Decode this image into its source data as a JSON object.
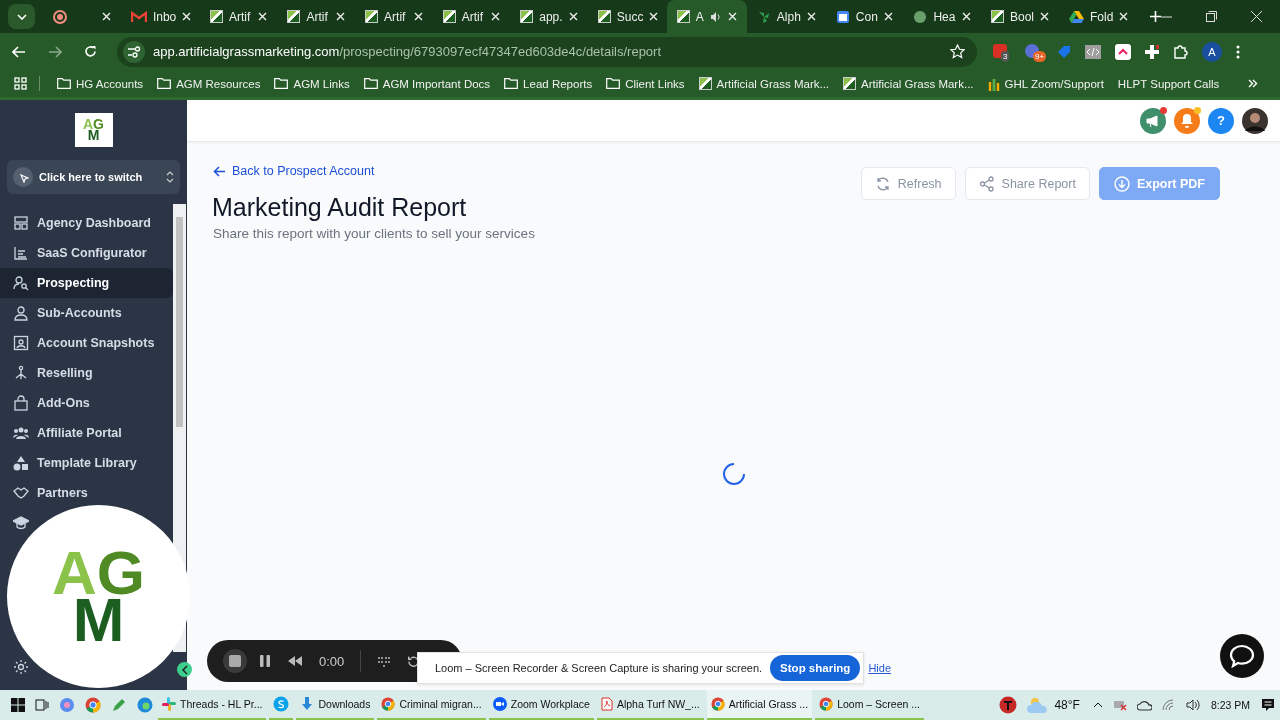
{
  "browser": {
    "tabs": [
      {
        "kind": "record",
        "selected": false
      },
      {
        "kind": "mail",
        "title": "Inbo",
        "selected": false
      },
      {
        "kind": "agm",
        "title": "Artif",
        "selected": false
      },
      {
        "kind": "agm",
        "title": "Artif",
        "selected": false
      },
      {
        "kind": "agm",
        "title": "Artif",
        "selected": false
      },
      {
        "kind": "agm",
        "title": "Artif",
        "selected": false
      },
      {
        "kind": "agm",
        "title": "app.",
        "selected": false
      },
      {
        "kind": "agm",
        "title": "Succ",
        "selected": false
      },
      {
        "kind": "agm",
        "title": "A",
        "selected": true,
        "audio": true
      },
      {
        "kind": "leaf",
        "title": "Alph",
        "selected": false
      },
      {
        "kind": "calendar",
        "title": "Con",
        "selected": false
      },
      {
        "kind": "globe",
        "title": "Hea",
        "selected": false
      },
      {
        "kind": "agm",
        "title": "Bool",
        "selected": false
      },
      {
        "kind": "drive",
        "title": "Fold",
        "selected": false
      }
    ],
    "url_host": "app.artificialgrassmarketing.com",
    "url_path": "/prospecting/6793097ecf47347ed603de4c/details/report",
    "extension_badges": [
      "3",
      "9+"
    ],
    "profile": "A",
    "bookmarks": [
      {
        "kind": "folder",
        "title": "HG Accounts"
      },
      {
        "kind": "folder",
        "title": "AGM Resources"
      },
      {
        "kind": "folder",
        "title": "AGM Links"
      },
      {
        "kind": "folder",
        "title": "AGM Important Docs"
      },
      {
        "kind": "folder",
        "title": "Lead Reports"
      },
      {
        "kind": "folder",
        "title": "Client Links"
      },
      {
        "kind": "agm",
        "title": "Artificial Grass Mark..."
      },
      {
        "kind": "agm",
        "title": "Artificial Grass Mark..."
      },
      {
        "kind": "bars",
        "title": "GHL Zoom/Support"
      },
      {
        "kind": "none",
        "title": "HLPT Support Calls"
      }
    ]
  },
  "sidebar_logo": [
    "A",
    "G",
    "M"
  ],
  "camera_logo": [
    "A",
    "G",
    "M"
  ],
  "switcher": "Click here to switch",
  "sidebar": {
    "items": [
      {
        "kind": "dashboard",
        "label": "Agency Dashboard",
        "selected": false
      },
      {
        "kind": "list",
        "label": "SaaS Configurator",
        "selected": false
      },
      {
        "kind": "search-person",
        "label": "Prospecting",
        "selected": true
      },
      {
        "kind": "person",
        "label": "Sub-Accounts",
        "selected": false
      },
      {
        "kind": "frame",
        "label": "Account Snapshots",
        "selected": false
      },
      {
        "kind": "tree",
        "label": "Reselling",
        "selected": false
      },
      {
        "kind": "bag",
        "label": "Add-Ons",
        "selected": false
      },
      {
        "kind": "people",
        "label": "Affiliate Portal",
        "selected": false
      },
      {
        "kind": "shapes",
        "label": "Template Library",
        "selected": false
      },
      {
        "kind": "handshake",
        "label": "Partners",
        "selected": false
      }
    ]
  },
  "header": {
    "notifications": [
      {
        "kind": "megaphone",
        "badge": true
      },
      {
        "kind": "bell",
        "badge": true
      },
      {
        "kind": "help",
        "label": "?",
        "badge": false
      }
    ]
  },
  "page": {
    "back_link": "Back to Prospect Account",
    "title": "Marketing Audit Report",
    "subtitle": "Share this report with your clients to sell your services",
    "actions": [
      {
        "kind": "refresh",
        "label": "Refresh",
        "primary": false
      },
      {
        "kind": "share",
        "label": "Share Report",
        "primary": false
      },
      {
        "kind": "download",
        "label": "Export PDF",
        "primary": true
      }
    ],
    "loading": true
  },
  "recorder": {
    "time": "0:00"
  },
  "loom_banner": {
    "message": "Loom – Screen Recorder & Screen Capture is sharing your screen.",
    "stop": "Stop sharing",
    "hide": "Hide"
  },
  "taskbar": {
    "apps": [
      {
        "kind": "threads",
        "label": "Threads - HL Pr...",
        "selected": false
      },
      {
        "kind": "skype",
        "selected": false
      },
      {
        "kind": "download",
        "label": "Downloads",
        "selected": false
      },
      {
        "kind": "chrome",
        "label": "Criminal migran...",
        "selected": false
      },
      {
        "kind": "zoom",
        "label": "Zoom Workplace",
        "selected": false
      },
      {
        "kind": "pdf",
        "label": "Alpha Turf NW_...",
        "selected": false
      },
      {
        "kind": "chrome",
        "label": "Artificial Grass ...",
        "selected": true
      },
      {
        "kind": "chrome",
        "label": "Loom – Screen ...",
        "selected": false
      }
    ],
    "temperature": "48°F",
    "time": "8:23 PM"
  }
}
